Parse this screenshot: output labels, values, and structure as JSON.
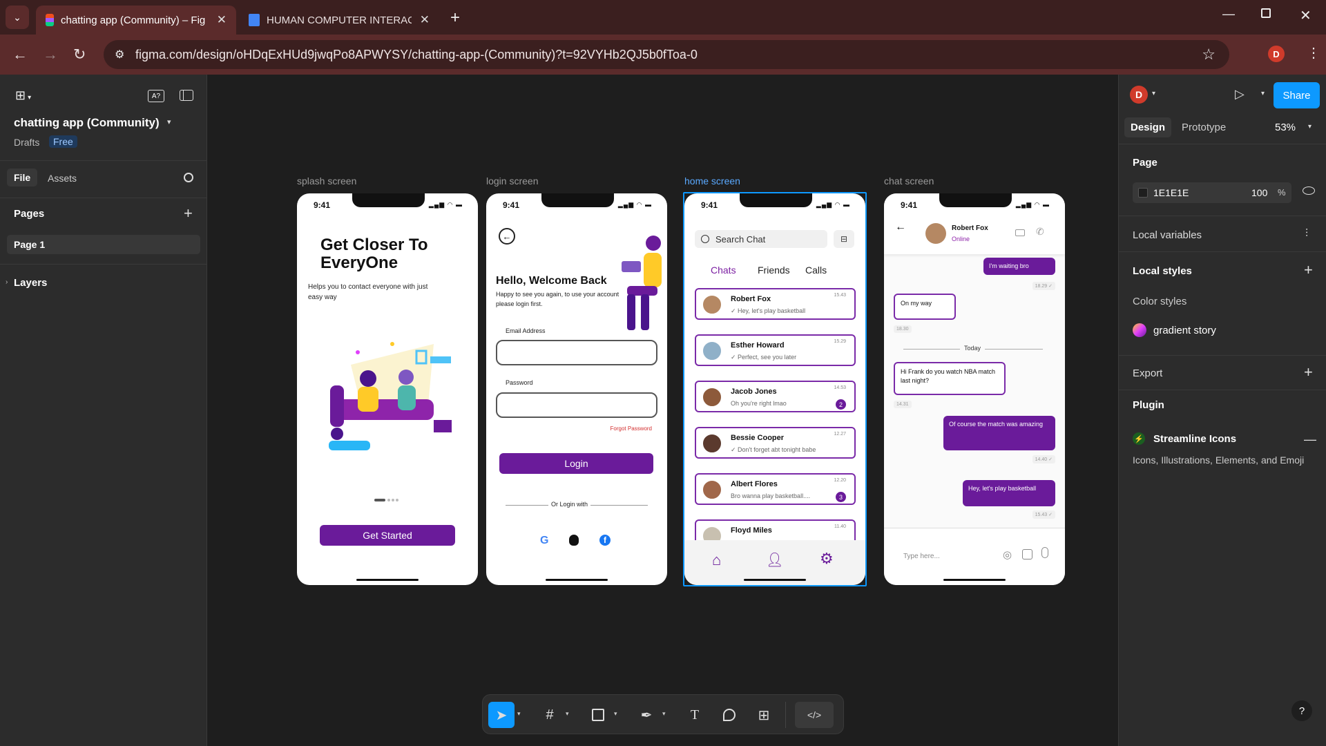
{
  "browser": {
    "tabs": [
      {
        "title": "chatting app (Community) – Fig"
      },
      {
        "title": "HUMAN COMPUTER INTERACT"
      }
    ],
    "url": "figma.com/design/oHDqExHUd9jwqPo8APWYSY/chatting-app-(Community)?t=92VYHb2QJ5b0fToa-0",
    "profile_initial": "D"
  },
  "left_panel": {
    "file_name": "chatting app (Community)",
    "location": "Drafts",
    "plan_badge": "Free",
    "tabs": [
      "File",
      "Assets"
    ],
    "pages_heading": "Pages",
    "pages": [
      "Page 1"
    ],
    "layers_heading": "Layers"
  },
  "right_panel": {
    "avatar_initial": "D",
    "share_label": "Share",
    "tabs": [
      "Design",
      "Prototype"
    ],
    "zoom": "53%",
    "page_heading": "Page",
    "page_color": "1E1E1E",
    "page_opacity": "100",
    "percent": "%",
    "local_variables": "Local variables",
    "local_styles": "Local styles",
    "color_styles": "Color styles",
    "gradient_style": "gradient story",
    "export": "Export",
    "plugin": "Plugin",
    "plugin_name": "Streamline Icons",
    "plugin_desc": "Icons, Illustrations, Elements, and Emoji",
    "help": "?"
  },
  "frames": {
    "splash": {
      "label": "splash screen",
      "time": "9:41",
      "title": "Get Closer To EveryOne",
      "subtitle": "Helps you to contact everyone with just easy way",
      "cta": "Get Started"
    },
    "login": {
      "label": "login screen",
      "time": "9:41",
      "title": "Hello, Welcome Back",
      "subtitle": "Happy to see you again, to use your account please login first.",
      "email_label": "Email Address",
      "password_label": "Password",
      "forgot": "Forgot Password",
      "login_btn": "Login",
      "or_login": "Or Login with"
    },
    "home": {
      "label": "home screen",
      "time": "9:41",
      "search_placeholder": "Search Chat",
      "tabs": [
        "Chats",
        "Friends",
        "Calls"
      ],
      "chats": [
        {
          "name": "Robert Fox",
          "msg": "Hey, let's play basketball",
          "time": "15.43",
          "badge": ""
        },
        {
          "name": "Esther Howard",
          "msg": "Perfect, see you later",
          "time": "15.29",
          "badge": ""
        },
        {
          "name": "Jacob Jones",
          "msg": "Oh you're right lmao",
          "time": "14.53",
          "badge": "2"
        },
        {
          "name": "Bessie Cooper",
          "msg": "Don't forget abt tonight babe",
          "time": "12.27",
          "badge": ""
        },
        {
          "name": "Albert Flores",
          "msg": "Bro wanna play basketball....",
          "time": "12.20",
          "badge": "3"
        },
        {
          "name": "Floyd Miles",
          "msg": "",
          "time": "11.40",
          "badge": ""
        }
      ]
    },
    "chat": {
      "label": "chat screen",
      "time": "9:41",
      "contact": "Robert Fox",
      "status": "Online",
      "messages": [
        {
          "dir": "out",
          "text": "I'm waiting bro",
          "time": "18.29"
        },
        {
          "dir": "in",
          "text": "On my way",
          "time": "18.30"
        },
        {
          "dir": "in",
          "text": "Hi Frank do you watch NBA match last night?",
          "time": "14.31"
        },
        {
          "dir": "out",
          "text": "Of course the match was amazing",
          "time": "14.40"
        },
        {
          "dir": "out",
          "text": "Hey, let's play basketball",
          "time": "15.43"
        }
      ],
      "divider": "Today",
      "input_placeholder": "Type here..."
    }
  },
  "colors": {
    "brand_purple": "#6a1b9a",
    "selection_blue": "#0d99ff",
    "share_blue": "#0d99ff"
  }
}
